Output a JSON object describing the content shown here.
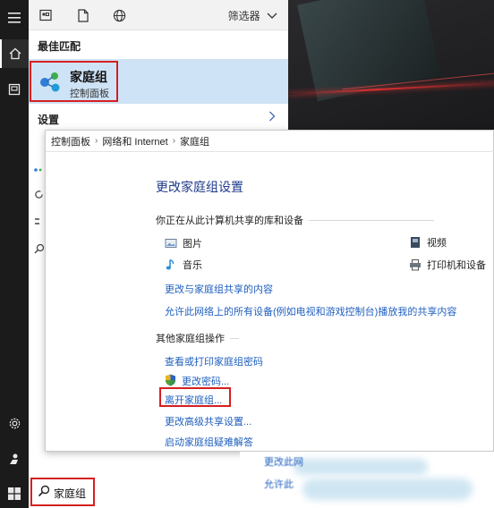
{
  "start_menu": {
    "filter_label": "筛选器",
    "best_match_header": "最佳匹配",
    "best_match": {
      "title": "家庭组",
      "subtitle": "控制面板"
    },
    "settings_header": "设置",
    "search": {
      "query": "家庭组"
    }
  },
  "control_panel": {
    "breadcrumb": [
      "控制面板",
      "网络和 Internet",
      "家庭组"
    ],
    "title": "更改家庭组设置",
    "shared_header": "你正在从此计算机共享的库和设备",
    "shared_items": {
      "pictures": "图片",
      "videos": "视频",
      "music": "音乐",
      "printers": "打印机和设备"
    },
    "links": {
      "change_shared": "更改与家庭组共享的内容",
      "allow_devices": "允许此网络上的所有设备(例如电视和游戏控制台)播放我的共享内容"
    },
    "actions_header": "其他家庭组操作",
    "actions": {
      "view_password": "查看或打印家庭组密码",
      "change_password": "更改密码...",
      "leave": "离开家庭组...",
      "advanced": "更改高级共享设置...",
      "troubleshoot": "启动家庭组疑难解答"
    },
    "obscured": {
      "line1": "更改此网",
      "line2": "允许此"
    }
  },
  "colors": {
    "accent_red": "#d52020",
    "link_blue": "#1f5fbf",
    "selection_blue": "#cfe3f6",
    "title_blue": "#1e3a8a"
  }
}
